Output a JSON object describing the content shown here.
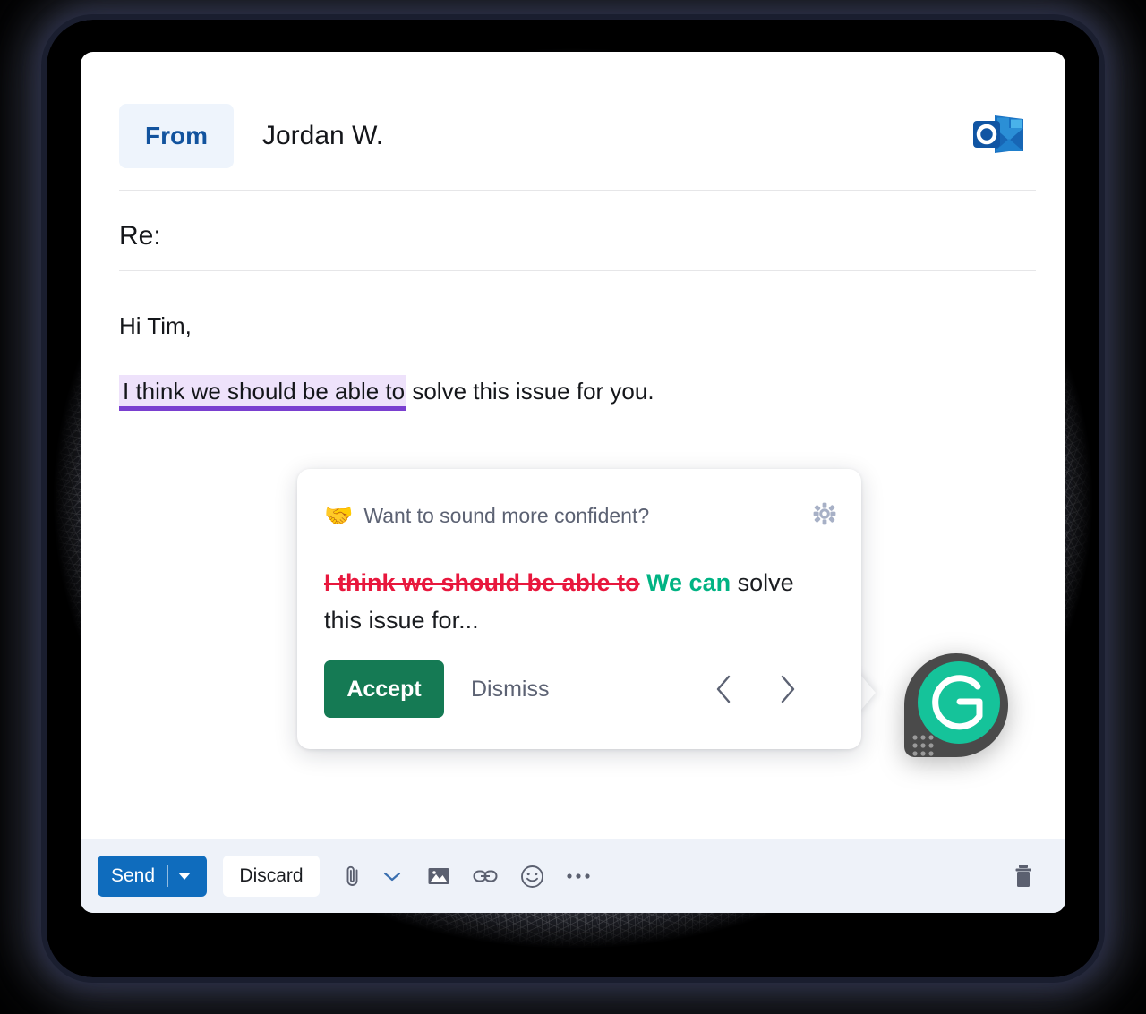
{
  "window": {
    "app": "Outlook Compose",
    "brand_logo": "outlook-logo"
  },
  "compose": {
    "from_label": "From",
    "from_value": "Jordan W.",
    "subject_value": "Re:",
    "body": {
      "greeting": "Hi Tim,",
      "highlighted_text": "I think we should be able to",
      "rest_text": " solve this issue for you.",
      "highlight_bg": "#eee2fb",
      "highlight_underline": "#7a3fd0"
    }
  },
  "suggestion_card": {
    "emoji": "🤝",
    "title": "Want to sound more confident?",
    "settings_icon": "gear-icon",
    "original_text": "I think we should be able to",
    "replacement_text": "We can",
    "remainder_text": "solve this issue for...",
    "accept_label": "Accept",
    "dismiss_label": "Dismiss",
    "prev_icon": "chevron-left-icon",
    "next_icon": "chevron-right-icon",
    "colors": {
      "strike": "#e8173d",
      "replacement": "#00b383",
      "accept_bg": "#157a54"
    }
  },
  "grammarly_widget": {
    "name": "grammarly-logo",
    "circle_color": "#15c39a",
    "shell_color": "#4a4a4a"
  },
  "toolbar": {
    "send_label": "Send",
    "send_dropdown_icon": "caret-down-icon",
    "discard_label": "Discard",
    "icons": [
      "attach-icon",
      "chevron-down-icon",
      "image-icon",
      "link-icon",
      "emoji-icon",
      "more-icon"
    ],
    "trash_icon": "trash-icon",
    "send_bg": "#0f6cbd",
    "bar_bg": "#eef2f9"
  }
}
